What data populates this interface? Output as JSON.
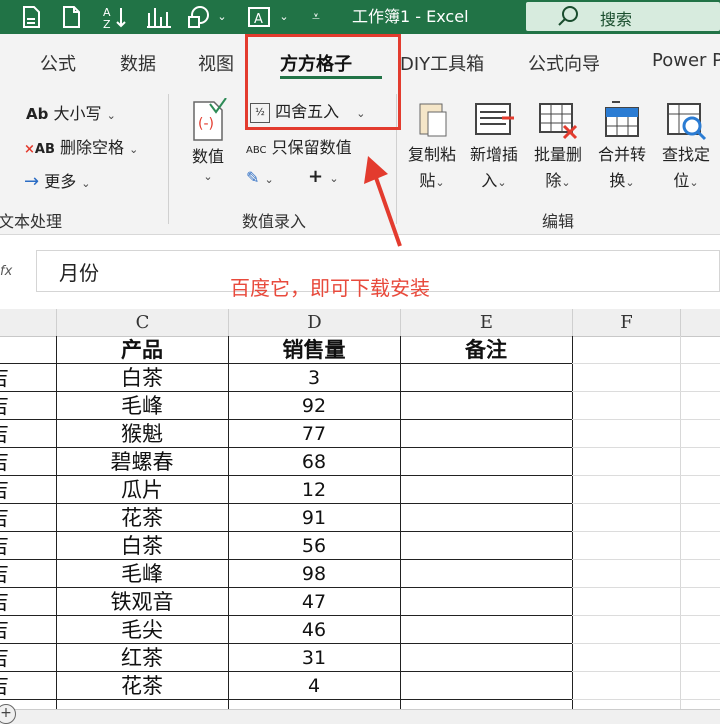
{
  "window": {
    "title": "工作簿1 - Excel",
    "search_label": "搜索"
  },
  "tabs": [
    {
      "label": "公式"
    },
    {
      "label": "数据"
    },
    {
      "label": "视图"
    },
    {
      "label": "方方格子"
    },
    {
      "label": "DIY工具箱"
    },
    {
      "label": "公式向导"
    },
    {
      "label": "Power P"
    }
  ],
  "ribbon": {
    "text_group": {
      "case_label": "大小写",
      "remove_space_label": "删除空格",
      "more_label": "更多",
      "group_label": "文本处理"
    },
    "numeric_group": {
      "value_btn_label": "数值",
      "round_label": "四舍五入",
      "keep_value_label": "只保留数值",
      "plus_symbol": "+",
      "group_label": "数值录入"
    },
    "edit_group": {
      "copy_paste_l1": "复制粘",
      "copy_paste_l2": "贴",
      "insert_l1": "新增插",
      "insert_l2": "入",
      "delete_l1": "批量删",
      "delete_l2": "除",
      "merge_l1": "合并转",
      "merge_l2": "换",
      "find_l1": "查找定",
      "find_l2": "位",
      "group_label": "编辑"
    }
  },
  "formula_bar": {
    "fx": "fx",
    "value": "月份"
  },
  "annotation": "百度它，即可下载安装",
  "columns": [
    "C",
    "D",
    "E",
    "F"
  ],
  "table": {
    "headers": [
      "产品",
      "销售量",
      "备注"
    ],
    "rows": [
      {
        "product": "白茶",
        "qty": "3"
      },
      {
        "product": "毛峰",
        "qty": "92"
      },
      {
        "product": "猴魁",
        "qty": "77"
      },
      {
        "product": "碧螺春",
        "qty": "68"
      },
      {
        "product": "瓜片",
        "qty": "12"
      },
      {
        "product": "花茶",
        "qty": "91"
      },
      {
        "product": "白茶",
        "qty": "56"
      },
      {
        "product": "毛峰",
        "qty": "98"
      },
      {
        "product": "铁观音",
        "qty": "47"
      },
      {
        "product": "毛尖",
        "qty": "46"
      },
      {
        "product": "红茶",
        "qty": "31"
      },
      {
        "product": "花茶",
        "qty": "4"
      }
    ],
    "partial_col_text": "吉"
  },
  "colors": {
    "accent": "#217346",
    "highlight": "#e33b2e",
    "annotation": "#e84a3c"
  }
}
